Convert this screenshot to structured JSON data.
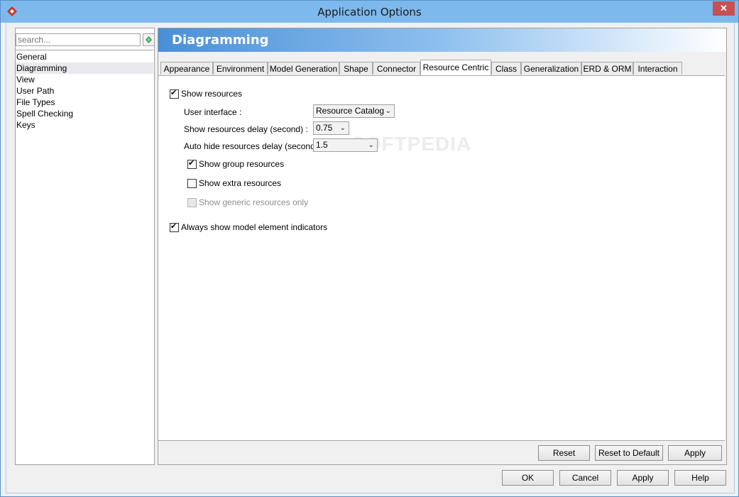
{
  "window": {
    "title": "Application Options"
  },
  "search": {
    "placeholder": "search..."
  },
  "tree": {
    "items": [
      {
        "label": "General"
      },
      {
        "label": "Diagramming"
      },
      {
        "label": "View"
      },
      {
        "label": "User Path"
      },
      {
        "label": "File Types"
      },
      {
        "label": "Spell Checking"
      },
      {
        "label": "Keys"
      }
    ],
    "selected": "Diagramming"
  },
  "panel": {
    "title": "Diagramming"
  },
  "tabs": [
    {
      "label": "Appearance"
    },
    {
      "label": "Environment"
    },
    {
      "label": "Model Generation"
    },
    {
      "label": "Shape"
    },
    {
      "label": "Connector"
    },
    {
      "label": "Resource Centric"
    },
    {
      "label": "Class"
    },
    {
      "label": "Generalization"
    },
    {
      "label": "ERD & ORM"
    },
    {
      "label": "Interaction"
    }
  ],
  "active_tab": "Resource Centric",
  "options": {
    "show_resources": {
      "label": "Show resources",
      "checked": true
    },
    "user_interface": {
      "label": "User interface :",
      "value": "Resource Catalog"
    },
    "show_delay": {
      "label": "Show resources delay (second) :",
      "value": "0.75"
    },
    "hide_delay": {
      "label": "Auto hide resources delay (second) :",
      "value": "1.5"
    },
    "group_resources": {
      "label": "Show group resources",
      "checked": true
    },
    "extra_resources": {
      "label": "Show extra resources",
      "checked": false
    },
    "generic_resources": {
      "label": "Show generic resources only",
      "checked": false,
      "disabled": true
    },
    "model_indicators": {
      "label": "Always show model element indicators",
      "checked": true
    }
  },
  "watermark": "SOFTPEDIA",
  "panel_buttons": {
    "reset": "Reset",
    "reset_default": "Reset to Default",
    "apply": "Apply"
  },
  "dialog_buttons": {
    "ok": "OK",
    "cancel": "Cancel",
    "apply": "Apply",
    "help": "Help"
  },
  "colors": {
    "titlebar": "#7db9ec",
    "banner_start": "#4a8fd6",
    "close_button": "#c75050"
  }
}
